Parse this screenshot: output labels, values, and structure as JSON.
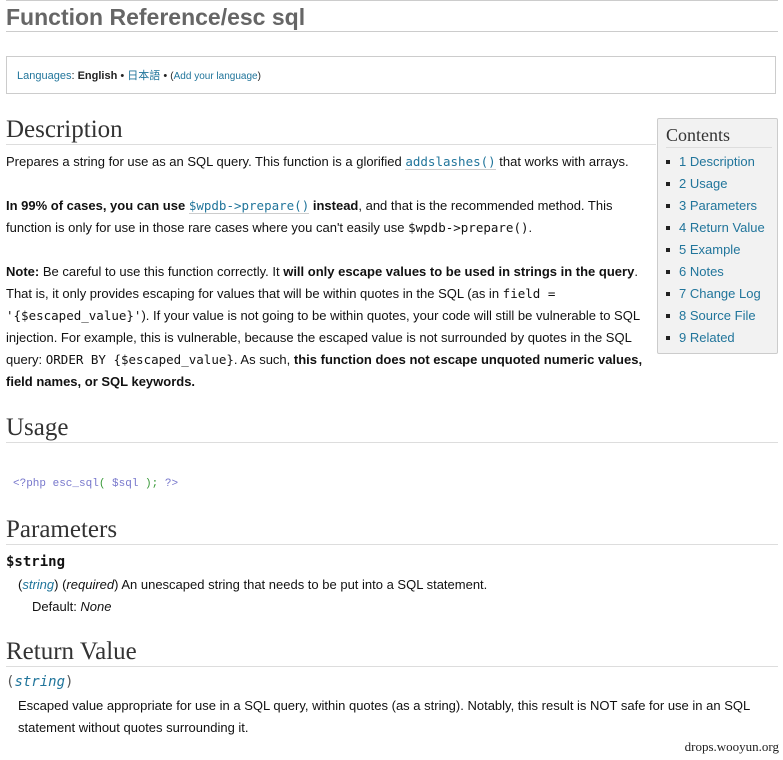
{
  "page": {
    "title": "Function Reference/esc sql"
  },
  "languages": {
    "label": "Languages",
    "separator": ":",
    "current": "English",
    "bullet": "•",
    "other": "日本語",
    "add_open": "(",
    "add_link": "Add your language",
    "add_close": ")"
  },
  "toc": {
    "title": "Contents",
    "items": [
      {
        "label": "1 Description"
      },
      {
        "label": "2 Usage"
      },
      {
        "label": "3 Parameters"
      },
      {
        "label": "4 Return Value"
      },
      {
        "label": "5 Example"
      },
      {
        "label": "6 Notes"
      },
      {
        "label": "7 Change Log"
      },
      {
        "label": "8 Source File"
      },
      {
        "label": "9 Related"
      }
    ]
  },
  "description": {
    "heading": "Description",
    "p1_a": "Prepares a string for use as an SQL query. This function is a glorified ",
    "p1_link": "addslashes()",
    "p1_b": " that works with arrays.",
    "p2_bold1": "In 99% of cases, you can use ",
    "p2_link": "$wpdb->prepare()",
    "p2_bold2": " instead",
    "p2_a": ", and that is the recommended method. This function is only for use in those rare cases where you can't easily use ",
    "p2_code": "$wpdb->prepare()",
    "p2_b": ".",
    "p3_note": "Note:",
    "p3_a": " Be careful to use this function correctly. It ",
    "p3_bold1": "will only escape values to be used in strings in the query",
    "p3_b": ". That is, it only provides escaping for values that will be within quotes in the SQL (as in ",
    "p3_code1": "field = '{$escaped_value}'",
    "p3_c": "). If your value is not going to be within quotes, your code will still be vulnerable to SQL injection. For example, this is vulnerable, because the escaped value is not surrounded by quotes in the SQL query: ",
    "p3_code2": "ORDER BY {$escaped_value}",
    "p3_d": ". As such, ",
    "p3_bold2": "this function does not escape unquoted numeric values, field names, or SQL keywords."
  },
  "usage": {
    "heading": "Usage",
    "code_open": "<?php esc_sql",
    "code_paren_open": "(",
    "code_var": " $sql ",
    "code_paren_close": ");",
    "code_close": " ?>"
  },
  "parameters": {
    "heading": "Parameters",
    "name": "$string",
    "type_open": "(",
    "type": "string",
    "type_close": ") (",
    "required": "required",
    "desc": ") An unescaped string that needs to be put into a SQL statement.",
    "default_label": "Default: ",
    "default_value": "None"
  },
  "return_value": {
    "heading": "Return Value",
    "type_open": "(",
    "type": "string",
    "type_close": ")",
    "desc": "Escaped value appropriate for use in a SQL query, within quotes (as a string). Notably, this result is NOT safe for use in an SQL statement without quotes surrounding it."
  },
  "watermark": "drops.wooyun.org"
}
